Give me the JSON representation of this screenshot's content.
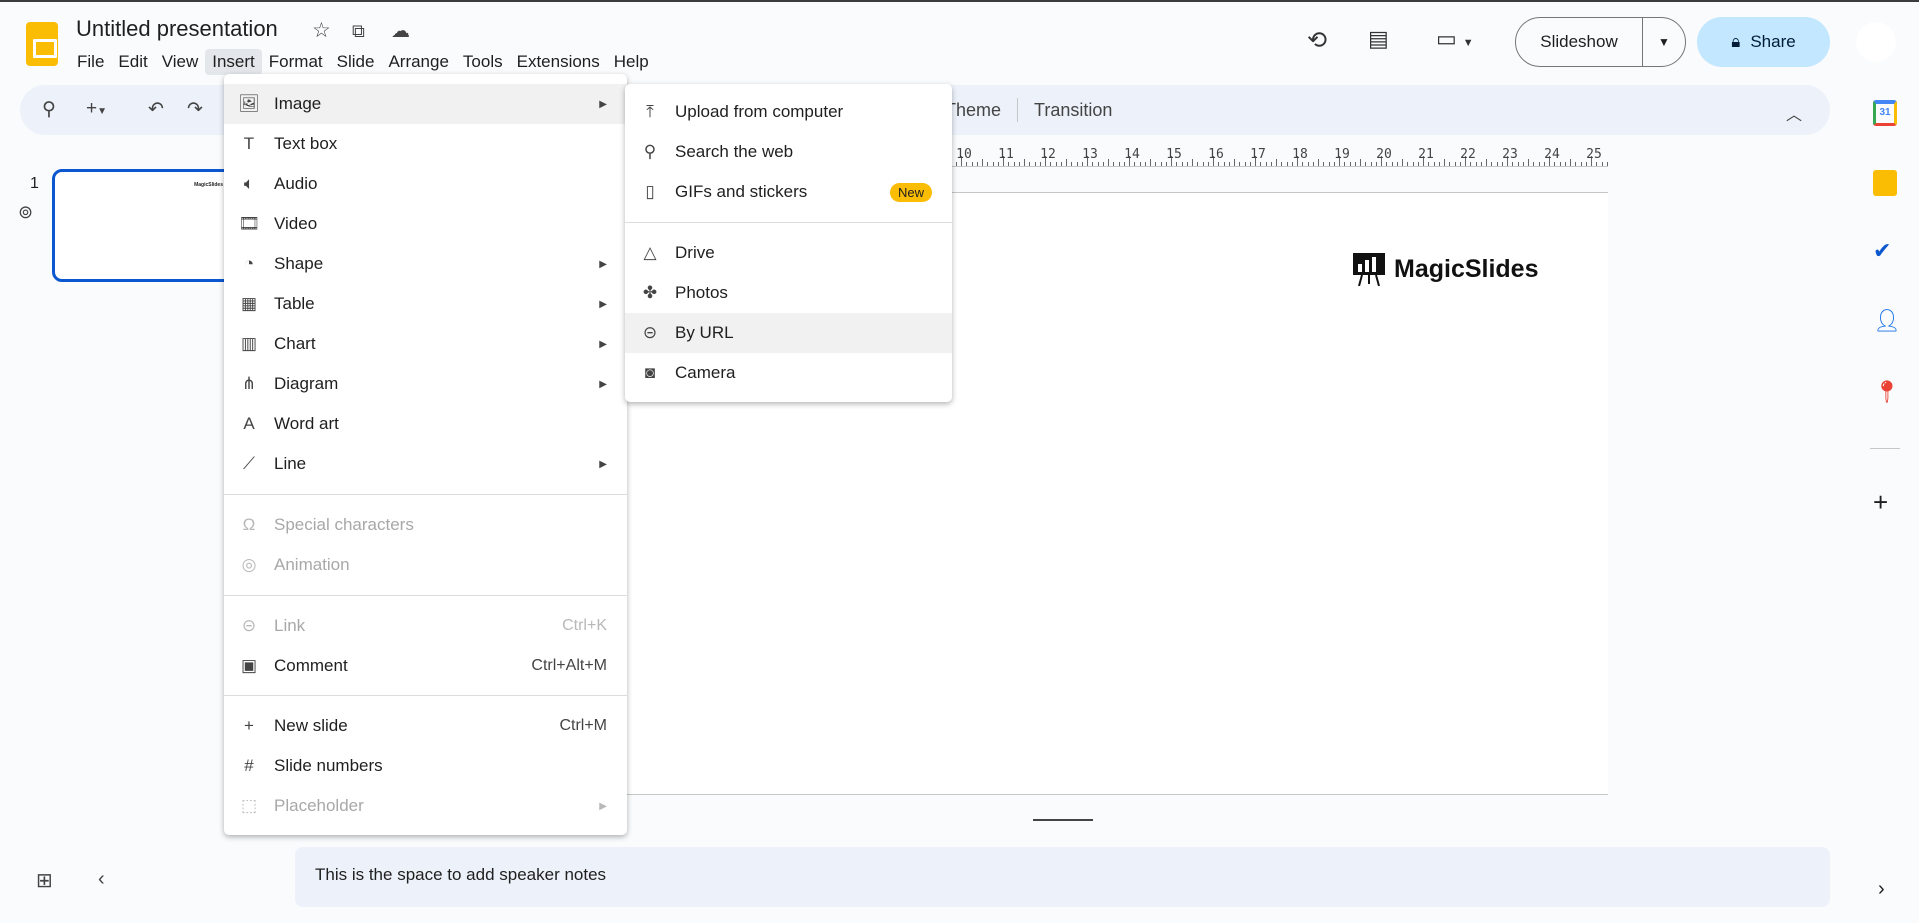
{
  "app": {
    "title": "Untitled presentation"
  },
  "menubar": [
    "File",
    "Edit",
    "View",
    "Insert",
    "Format",
    "Slide",
    "Arrange",
    "Tools",
    "Extensions",
    "Help"
  ],
  "header": {
    "slideshow": "Slideshow",
    "share": "Share"
  },
  "toolbar": {
    "theme": "Theme",
    "transition": "Transition"
  },
  "ruler": {
    "numbers": [
      10,
      11,
      12,
      13,
      14,
      15,
      16,
      17,
      18,
      19,
      20,
      21,
      22,
      23,
      24,
      25
    ]
  },
  "filmstrip": {
    "slide_number": "1",
    "thumb_text": "MagicSlides"
  },
  "slide": {
    "logo_text": "MagicSlides"
  },
  "notes": {
    "placeholder": "This is the space to add speaker notes"
  },
  "insert_menu": [
    {
      "label": "Image",
      "icon": "image-icon",
      "arrow": true
    },
    {
      "label": "Text box",
      "icon": "text-box-icon"
    },
    {
      "label": "Audio",
      "icon": "audio-icon"
    },
    {
      "label": "Video",
      "icon": "video-icon"
    },
    {
      "label": "Shape",
      "icon": "shape-icon",
      "arrow": true
    },
    {
      "label": "Table",
      "icon": "table-icon",
      "arrow": true
    },
    {
      "label": "Chart",
      "icon": "chart-icon",
      "arrow": true
    },
    {
      "label": "Diagram",
      "icon": "diagram-icon",
      "arrow": true
    },
    {
      "label": "Word art",
      "icon": "word-art-icon"
    },
    {
      "label": "Line",
      "icon": "line-icon",
      "arrow": true
    },
    {
      "label": "Special characters",
      "icon": "omega-icon",
      "disabled": true
    },
    {
      "label": "Animation",
      "icon": "animation-icon",
      "disabled": true
    },
    {
      "label": "Link",
      "icon": "link-icon",
      "shortcut": "Ctrl+K",
      "disabled": true
    },
    {
      "label": "Comment",
      "icon": "comment-icon",
      "shortcut": "Ctrl+Alt+M"
    },
    {
      "label": "New slide",
      "icon": "plus-icon",
      "shortcut": "Ctrl+M"
    },
    {
      "label": "Slide numbers",
      "icon": "hash-icon"
    },
    {
      "label": "Placeholder",
      "icon": "placeholder-icon",
      "arrow": true,
      "disabled": true
    }
  ],
  "image_submenu": [
    {
      "label": "Upload from computer",
      "icon": "upload-icon"
    },
    {
      "label": "Search the web",
      "icon": "search-icon"
    },
    {
      "label": "GIFs and stickers",
      "icon": "gif-icon",
      "badge": "New"
    },
    {
      "label": "Drive",
      "icon": "drive-icon"
    },
    {
      "label": "Photos",
      "icon": "photos-icon"
    },
    {
      "label": "By URL",
      "icon": "link-icon"
    },
    {
      "label": "Camera",
      "icon": "camera-icon"
    }
  ],
  "colors": {
    "accent": "#0b57d0",
    "share_bg": "#c2e7ff",
    "badge": "#fbbc04"
  }
}
